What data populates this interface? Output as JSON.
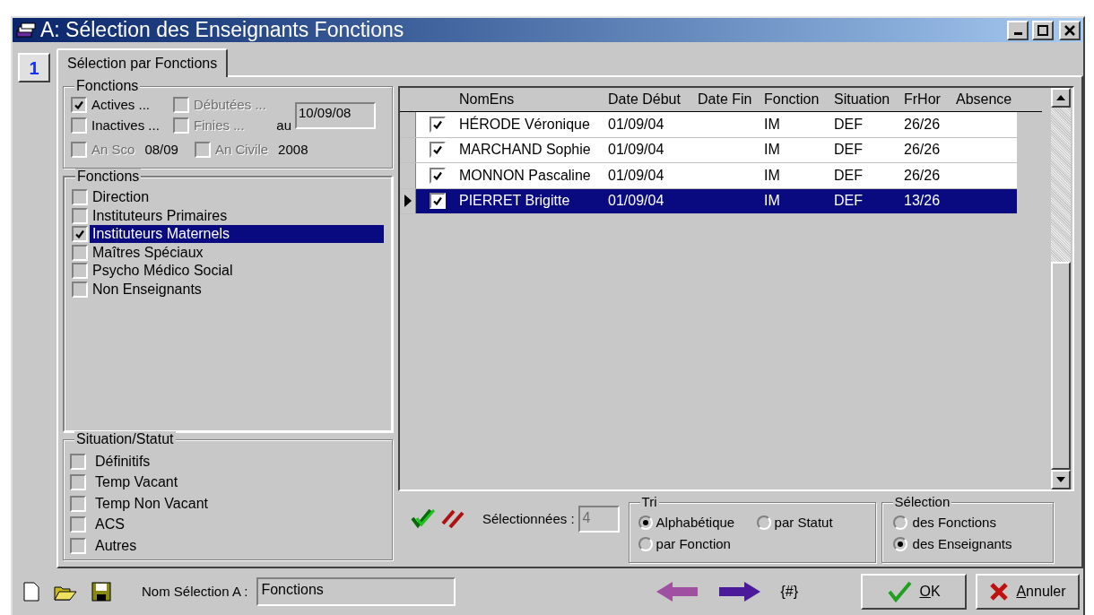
{
  "window": {
    "title": "A: Sélection des Enseignants Fonctions"
  },
  "page_number": "1",
  "tabs": [
    {
      "label": "Sélection par Fonctions",
      "selected": true
    }
  ],
  "period": {
    "title": "Fonctions",
    "options": [
      {
        "label": "Actives ...",
        "checked": true,
        "disabled": false
      },
      {
        "label": "Débutées ...",
        "checked": false,
        "disabled": true
      },
      {
        "label": "Inactives ...",
        "checked": false,
        "disabled": false
      },
      {
        "label": "Finies ...",
        "checked": false,
        "disabled": true
      }
    ],
    "date_label": "au",
    "date_value": "10/09/08",
    "years": [
      {
        "label": "An Sco",
        "checked": false,
        "disabled": true,
        "value": "08/09"
      },
      {
        "label": "An Civile",
        "checked": false,
        "disabled": true,
        "value": "2008"
      }
    ]
  },
  "functions": {
    "title": "Fonctions",
    "items": [
      {
        "label": "Direction",
        "checked": false,
        "selected": false
      },
      {
        "label": "Instituteurs Primaires",
        "checked": false,
        "selected": false
      },
      {
        "label": "Instituteurs Maternels",
        "checked": true,
        "selected": true
      },
      {
        "label": "Maîtres Spéciaux",
        "checked": false,
        "selected": false
      },
      {
        "label": "Psycho Médico Social",
        "checked": false,
        "selected": false
      },
      {
        "label": "Non Enseignants",
        "checked": false,
        "selected": false
      }
    ]
  },
  "situation": {
    "title": "Situation/Statut",
    "items": [
      {
        "label": "Définitifs",
        "checked": false
      },
      {
        "label": "Temp Vacant",
        "checked": false
      },
      {
        "label": "Temp Non Vacant",
        "checked": false
      },
      {
        "label": "ACS",
        "checked": false
      },
      {
        "label": "Autres",
        "checked": false
      }
    ]
  },
  "table": {
    "columns": [
      "NomEns",
      "Date Début",
      "Date Fin",
      "Fonction",
      "Situation",
      "FrHor",
      "Absence"
    ],
    "rows": [
      {
        "checked": true,
        "selected": false,
        "nom": "HÉRODE Véronique",
        "date_debut": "01/09/04",
        "fonction": "IM",
        "situation": "DEF",
        "frhor": "26/26"
      },
      {
        "checked": true,
        "selected": false,
        "nom": "MARCHAND Sophie",
        "date_debut": "01/09/04",
        "fonction": "IM",
        "situation": "DEF",
        "frhor": "26/26"
      },
      {
        "checked": true,
        "selected": false,
        "nom": "MONNON Pascaline",
        "date_debut": "01/09/04",
        "fonction": "IM",
        "situation": "DEF",
        "frhor": "26/26"
      },
      {
        "checked": true,
        "selected": true,
        "nom": "PIERRET Brigitte",
        "date_debut": "01/09/04",
        "fonction": "IM",
        "situation": "DEF",
        "frhor": "13/26"
      }
    ]
  },
  "count": {
    "label": "Sélectionnées :",
    "value": "4"
  },
  "sort": {
    "title": "Tri",
    "options": [
      {
        "label": "Alphabétique",
        "selected": true
      },
      {
        "label": "par Statut",
        "selected": false
      },
      {
        "label": "par Fonction",
        "selected": false
      }
    ]
  },
  "selection": {
    "title": "Sélection",
    "options": [
      {
        "label": "des Fonctions",
        "selected": false
      },
      {
        "label": "des Enseignants",
        "selected": true
      }
    ]
  },
  "footer": {
    "name_label": "Nom Sélection A :",
    "name_value": "Fonctions",
    "counter": "{#}",
    "buttons": [
      {
        "kind": "ok",
        "label": "OK"
      },
      {
        "kind": "cancel",
        "label": "Annuler"
      }
    ]
  }
}
